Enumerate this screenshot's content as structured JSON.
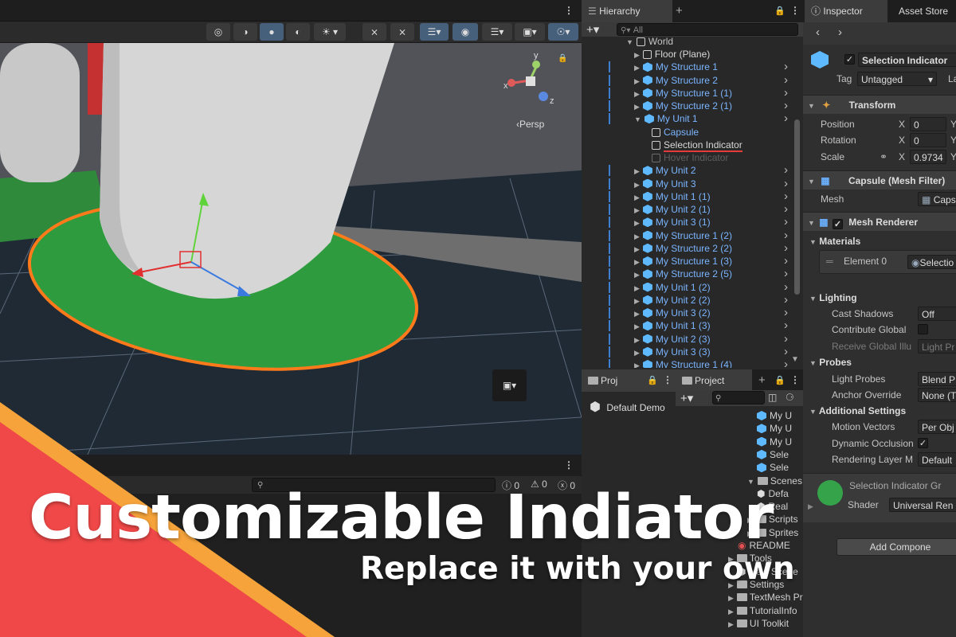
{
  "scene": {
    "toolbar_icons": [
      "globe-icon",
      "sphere-wire-icon",
      "sphere-shaded-icon",
      "half-sphere-icon",
      "light-icon",
      "audio-mute-icon",
      "fx-icon",
      "layers-icon",
      "visibility-icon",
      "layers-stack-icon",
      "camera-icon",
      "gizmo-icon"
    ],
    "persp_label": "‹Persp",
    "axis_x": "x",
    "axis_y": "y",
    "axis_z": "z"
  },
  "console": {
    "count_info": "0",
    "count_warn": "0",
    "count_error": "0"
  },
  "banner": {
    "title": "Customizable Indiator",
    "subtitle": "Replace it with your own"
  },
  "hierarchy": {
    "tab": "Hierarchy",
    "search_placeholder": "All",
    "root": "World",
    "items": [
      {
        "label": "Floor (Plane)",
        "style": "white",
        "indent": 1
      },
      {
        "label": "My Structure 1",
        "style": "blue",
        "indent": 1
      },
      {
        "label": "My Structure 2",
        "style": "blue",
        "indent": 1
      },
      {
        "label": "My Structure 1 (1)",
        "style": "blue",
        "indent": 1
      },
      {
        "label": "My Structure 2 (1)",
        "style": "blue",
        "indent": 1
      },
      {
        "label": "My Unit 1",
        "style": "blue",
        "indent": 1
      },
      {
        "label": "Capsule",
        "style": "blue",
        "indent": 2
      },
      {
        "label": "Selection Indicator",
        "style": "white",
        "indent": 2
      },
      {
        "label": "Hover Indicator",
        "style": "dim",
        "indent": 2
      },
      {
        "label": "My Unit 2",
        "style": "blue",
        "indent": 1
      },
      {
        "label": "My Unit 3",
        "style": "blue",
        "indent": 1
      },
      {
        "label": "My Unit 1 (1)",
        "style": "blue",
        "indent": 1
      },
      {
        "label": "My Unit 2 (1)",
        "style": "blue",
        "indent": 1
      },
      {
        "label": "My Unit 3 (1)",
        "style": "blue",
        "indent": 1
      },
      {
        "label": "My Structure 1 (2)",
        "style": "blue",
        "indent": 1
      },
      {
        "label": "My Structure 2 (2)",
        "style": "blue",
        "indent": 1
      },
      {
        "label": "My Structure 1 (3)",
        "style": "blue",
        "indent": 1
      },
      {
        "label": "My Structure 2 (5)",
        "style": "blue",
        "indent": 1
      },
      {
        "label": "My Unit 1 (2)",
        "style": "blue",
        "indent": 1
      },
      {
        "label": "My Unit 2 (2)",
        "style": "blue",
        "indent": 1
      },
      {
        "label": "My Unit 3 (2)",
        "style": "blue",
        "indent": 1
      },
      {
        "label": "My Unit 1 (3)",
        "style": "blue",
        "indent": 1
      },
      {
        "label": "My Unit 2 (3)",
        "style": "blue",
        "indent": 1
      },
      {
        "label": "My Unit 3 (3)",
        "style": "blue",
        "indent": 1
      },
      {
        "label": "My Structure 1 (4)",
        "style": "blue",
        "indent": 1
      }
    ]
  },
  "project_left": {
    "tab": "Proj",
    "item": "Default Demo"
  },
  "project": {
    "tab": "Project",
    "assets": [
      {
        "label": "My U",
        "type": "prefab",
        "indent": 0
      },
      {
        "label": "My U",
        "type": "prefab",
        "indent": 0
      },
      {
        "label": "My U",
        "type": "prefab",
        "indent": 0
      },
      {
        "label": "Sele",
        "type": "prefab",
        "indent": 0
      },
      {
        "label": "Sele",
        "type": "prefab",
        "indent": 0
      },
      {
        "label": "Scenes",
        "type": "folder-open",
        "indent": -1
      },
      {
        "label": "Defa",
        "type": "scene",
        "indent": 0
      },
      {
        "label": "Real",
        "type": "scene",
        "indent": 0
      },
      {
        "label": "Scripts",
        "type": "folder",
        "indent": -1
      },
      {
        "label": "Sprites",
        "type": "folder",
        "indent": -1
      },
      {
        "label": "README",
        "type": "readme",
        "indent": -2
      },
      {
        "label": "Tools",
        "type": "folder",
        "indent": -3
      },
      {
        "label": "New Scene",
        "type": "scene",
        "indent": -2
      },
      {
        "label": "Settings",
        "type": "folder",
        "indent": -3
      },
      {
        "label": "TextMesh Pro",
        "type": "folder",
        "indent": -3
      },
      {
        "label": "TutorialInfo",
        "type": "folder",
        "indent": -3
      },
      {
        "label": "UI Toolkit",
        "type": "folder",
        "indent": -3
      }
    ]
  },
  "inspector": {
    "tab": "Inspector",
    "tab2": "Asset Store",
    "object_name": "Selection Indicator",
    "tag_label": "Tag",
    "tag_value": "Untagged",
    "layer_label": "La",
    "transform": {
      "title": "Transform",
      "position_label": "Position",
      "rotation_label": "Rotation",
      "scale_label": "Scale",
      "x": "X",
      "y": "Y",
      "pos_x": "0",
      "rot_x": "0",
      "scale_x": "0.9734"
    },
    "mesh_filter": {
      "title": "Capsule (Mesh Filter)",
      "mesh_label": "Mesh",
      "mesh_value": "Caps"
    },
    "mesh_renderer": {
      "title": "Mesh Renderer",
      "materials_label": "Materials",
      "element_label": "Element 0",
      "element_value": "Selectio",
      "lighting_label": "Lighting",
      "cast_shadows_label": "Cast Shadows",
      "cast_shadows_value": "Off",
      "contribute_gi_label": "Contribute Global",
      "receive_gi_label": "Receive Global Illu",
      "receive_gi_value": "Light Pr",
      "probes_label": "Probes",
      "light_probes_label": "Light Probes",
      "light_probes_value": "Blend P",
      "anchor_label": "Anchor Override",
      "anchor_value": "None (T",
      "additional_label": "Additional Settings",
      "motion_label": "Motion Vectors",
      "motion_value": "Per Obj",
      "dynamic_occ_label": "Dynamic Occlusion",
      "rendering_layer_label": "Rendering Layer M",
      "rendering_layer_value": "Default"
    },
    "material": {
      "name": "Selection Indicator Gr",
      "shader_label": "Shader",
      "shader_value": "Universal Ren"
    },
    "add_component": "Add Compone"
  },
  "colors": {
    "indicator_green": "#34a34a",
    "indicator_outline": "#ff7a1a",
    "banner_red": "#f04848",
    "banner_orange": "#f5a33a",
    "hierarchy_blue": "#7ab5ff"
  }
}
